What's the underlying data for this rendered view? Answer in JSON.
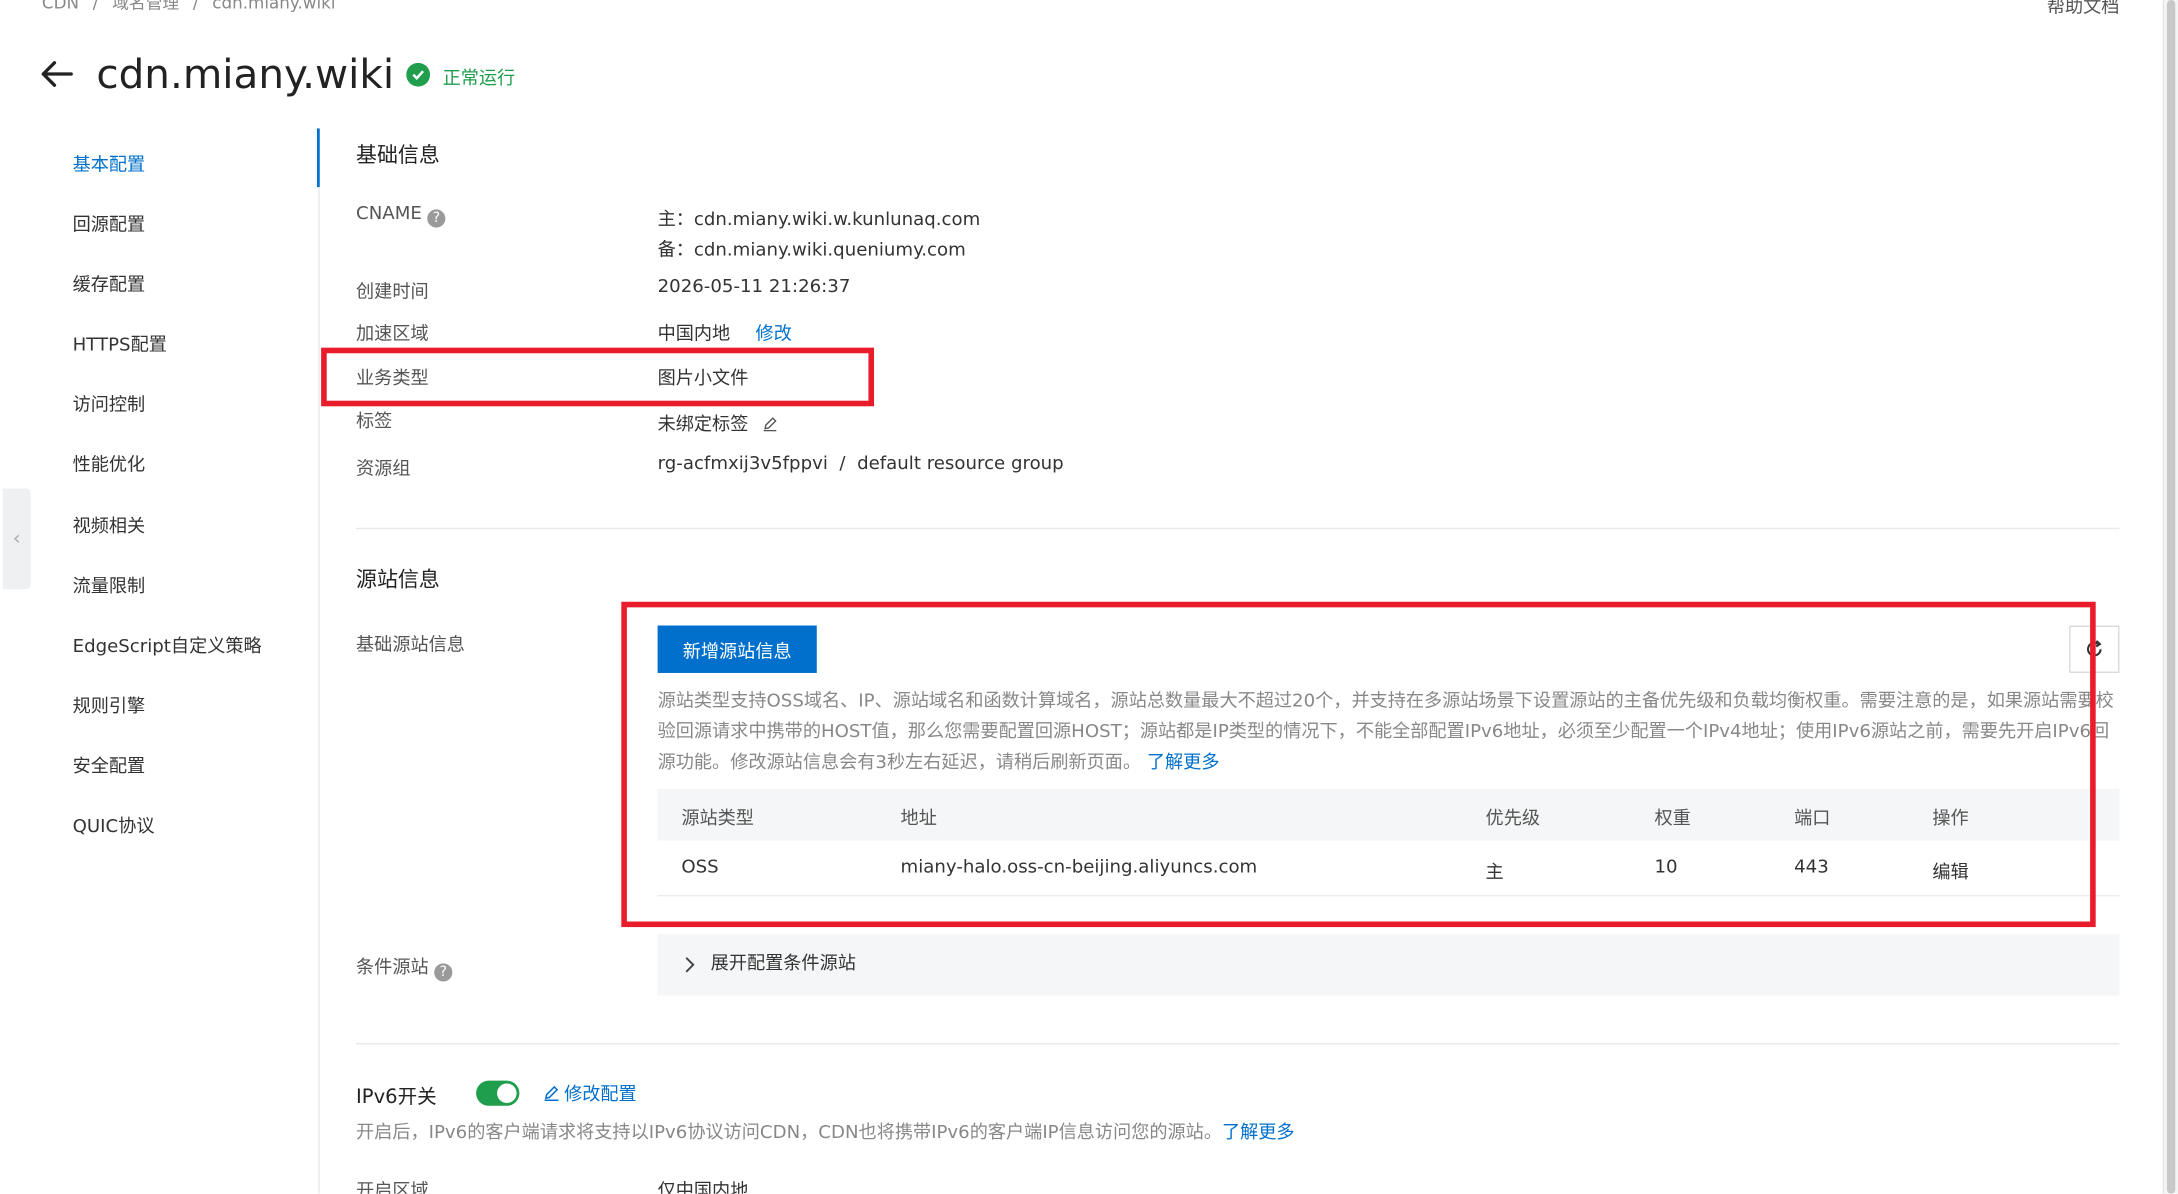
{
  "breadcrumb": [
    "CDN",
    "/",
    "域名管理",
    "/",
    "cdn.miany.wiki"
  ],
  "help_doc": "帮助文档",
  "title": "cdn.miany.wiki",
  "status": "正常运行",
  "nav": [
    {
      "label": "基本配置",
      "active": true
    },
    {
      "label": "回源配置"
    },
    {
      "label": "缓存配置"
    },
    {
      "label": "HTTPS配置"
    },
    {
      "label": "访问控制"
    },
    {
      "label": "性能优化"
    },
    {
      "label": "视频相关"
    },
    {
      "label": "流量限制"
    },
    {
      "label": "EdgeScript自定义策略"
    },
    {
      "label": "规则引擎"
    },
    {
      "label": "安全配置"
    },
    {
      "label": "QUIC协议"
    }
  ],
  "basic": {
    "title": "基础信息",
    "cname_label": "CNAME",
    "cname_main": "主：cdn.miany.wiki.w.kunlunaq.com",
    "cname_backup": "备：cdn.miany.wiki.queniumy.com",
    "created_label": "创建时间",
    "created_value": "2026-05-11 21:26:37",
    "region_label": "加速区域",
    "region_value": "中国内地",
    "region_edit": "修改",
    "biz_label": "业务类型",
    "biz_value": "图片小文件",
    "tag_label": "标签",
    "tag_value": "未绑定标签",
    "rg_label": "资源组",
    "rg_value": "rg-acfmxij3v5fppvi  /  default resource group"
  },
  "origin": {
    "title": "源站信息",
    "basic_label": "基础源站信息",
    "add_button": "新增源站信息",
    "description": "源站类型支持OSS域名、IP、源站域名和函数计算域名，源站总数量最大不超过20个，并支持在多源站场景下设置源站的主备优先级和负载均衡权重。需要注意的是，如果源站需要校验回源请求中携带的HOST值，那么您需要配置回源HOST；源站都是IP类型的情况下，不能全部配置IPv6地址，必须至少配置一个IPv4地址；使用IPv6源站之前，需要先开启IPv6回源功能。修改源站信息会有3秒左右延迟，请稍后刷新页面。",
    "learn_more": "了解更多",
    "columns": [
      "源站类型",
      "地址",
      "优先级",
      "权重",
      "端口",
      "操作"
    ],
    "rows": [
      {
        "type": "OSS",
        "address": "miany-halo.oss-cn-beijing.aliyuncs.com",
        "priority": "主",
        "weight": "10",
        "port": "443",
        "action": "编辑"
      }
    ],
    "cond_label": "条件源站",
    "cond_expand": "展开配置条件源站"
  },
  "ipv6": {
    "title": "IPv6开关",
    "enabled": true,
    "edit": "修改配置",
    "desc": "开启后，IPv6的客户端请求将支持以IPv6协议访问CDN，CDN也将携带IPv6的客户端IP信息访问您的源站。",
    "learn_more": "了解更多",
    "region_label": "开启区域",
    "region_value": "仅中国内地"
  },
  "colors": {
    "accent": "#0070cc",
    "success": "#1f9e4d",
    "highlight": "#e81c2b"
  }
}
